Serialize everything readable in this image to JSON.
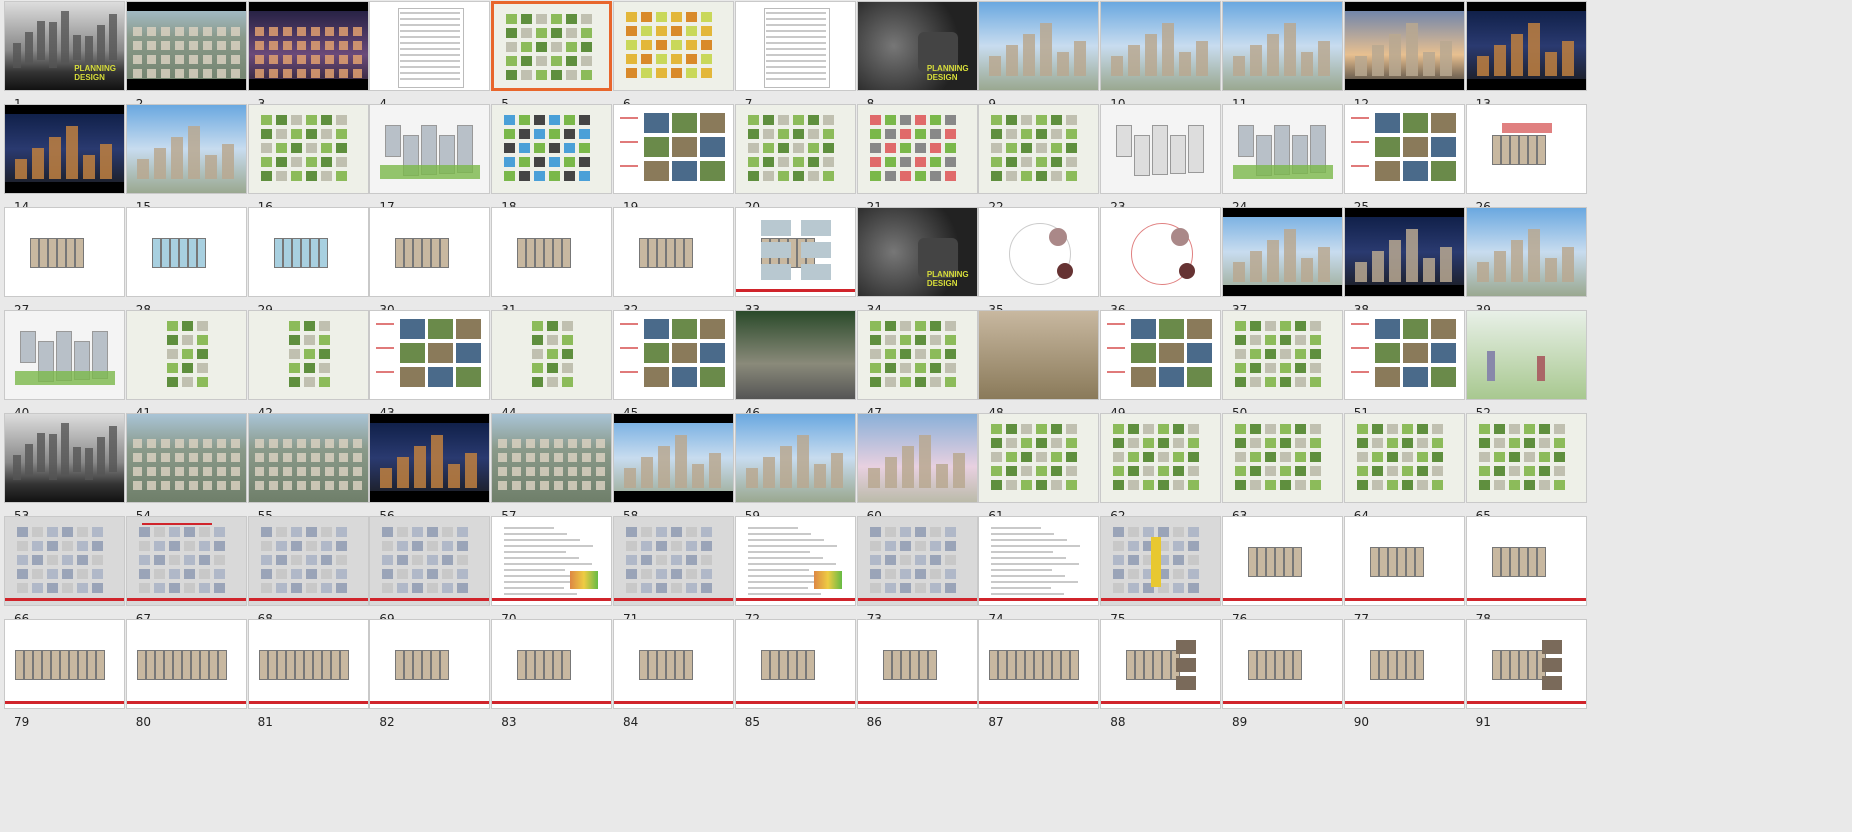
{
  "app": {
    "view": "slide sorter",
    "selected_slide": 5
  },
  "slides": [
    {
      "num": "1",
      "kind": "city-bw",
      "logo": "PLANNING\nDESIGN"
    },
    {
      "num": "2",
      "kind": "aerial"
    },
    {
      "num": "3",
      "kind": "aerial-night"
    },
    {
      "num": "4",
      "kind": "table"
    },
    {
      "num": "5",
      "kind": "plan-green"
    },
    {
      "num": "6",
      "kind": "plan-color"
    },
    {
      "num": "7",
      "kind": "table"
    },
    {
      "num": "8",
      "kind": "chairs",
      "logo": "PLANNING\nDESIGN"
    },
    {
      "num": "9",
      "kind": "render-day"
    },
    {
      "num": "10",
      "kind": "render-canal"
    },
    {
      "num": "11",
      "kind": "render-park"
    },
    {
      "num": "12",
      "kind": "render-dusk"
    },
    {
      "num": "13",
      "kind": "render-night"
    },
    {
      "num": "14",
      "kind": "render-night2"
    },
    {
      "num": "15",
      "kind": "render-street"
    },
    {
      "num": "16",
      "kind": "plan-mixed"
    },
    {
      "num": "17",
      "kind": "massing"
    },
    {
      "num": "18",
      "kind": "plan-blue"
    },
    {
      "num": "19",
      "kind": "photo-grid"
    },
    {
      "num": "20",
      "kind": "plan-mixed"
    },
    {
      "num": "21",
      "kind": "plan-red"
    },
    {
      "num": "22",
      "kind": "plan-mixed"
    },
    {
      "num": "23",
      "kind": "sketch"
    },
    {
      "num": "24",
      "kind": "massing-green"
    },
    {
      "num": "25",
      "kind": "photo-grid"
    },
    {
      "num": "26",
      "kind": "floorplan-red"
    },
    {
      "num": "27",
      "kind": "floorplan"
    },
    {
      "num": "28",
      "kind": "floorplan-blue"
    },
    {
      "num": "29",
      "kind": "floorplan-blue"
    },
    {
      "num": "30",
      "kind": "floorplan"
    },
    {
      "num": "31",
      "kind": "floorplan"
    },
    {
      "num": "32",
      "kind": "floorplan"
    },
    {
      "num": "33",
      "kind": "unit-grid"
    },
    {
      "num": "34",
      "kind": "chairs",
      "logo": "PLANNING\nDESIGN"
    },
    {
      "num": "35",
      "kind": "concept"
    },
    {
      "num": "36",
      "kind": "concept-pink"
    },
    {
      "num": "37",
      "kind": "render-resi"
    },
    {
      "num": "38",
      "kind": "render-resi-dark"
    },
    {
      "num": "39",
      "kind": "render-resi-day"
    },
    {
      "num": "40",
      "kind": "diagram-3d"
    },
    {
      "num": "41",
      "kind": "plan-narrow"
    },
    {
      "num": "42",
      "kind": "plan-narrow"
    },
    {
      "num": "43",
      "kind": "photo-grid"
    },
    {
      "num": "44",
      "kind": "plan-narrow"
    },
    {
      "num": "45",
      "kind": "photo-grid"
    },
    {
      "num": "46",
      "kind": "photo-courtyard"
    },
    {
      "num": "47",
      "kind": "plan-garden"
    },
    {
      "num": "48",
      "kind": "photo-villa"
    },
    {
      "num": "49",
      "kind": "photo-grid"
    },
    {
      "num": "50",
      "kind": "plan-path"
    },
    {
      "num": "51",
      "kind": "photo-grid"
    },
    {
      "num": "52",
      "kind": "section-people"
    },
    {
      "num": "53",
      "kind": "city-bw2"
    },
    {
      "num": "54",
      "kind": "aerial-resi"
    },
    {
      "num": "55",
      "kind": "aerial-resi2"
    },
    {
      "num": "56",
      "kind": "render-entry-night"
    },
    {
      "num": "57",
      "kind": "aerial-resi3"
    },
    {
      "num": "58",
      "kind": "render-pool"
    },
    {
      "num": "59",
      "kind": "render-gate"
    },
    {
      "num": "60",
      "kind": "render-blossom"
    },
    {
      "num": "61",
      "kind": "site-plan"
    },
    {
      "num": "62",
      "kind": "site-plan"
    },
    {
      "num": "63",
      "kind": "site-plan"
    },
    {
      "num": "64",
      "kind": "site-plan"
    },
    {
      "num": "65",
      "kind": "site-plan"
    },
    {
      "num": "66",
      "kind": "site-gray"
    },
    {
      "num": "67",
      "kind": "site-gray-red"
    },
    {
      "num": "68",
      "kind": "site-gray-green"
    },
    {
      "num": "69",
      "kind": "site-gray-photos"
    },
    {
      "num": "70",
      "kind": "text-page"
    },
    {
      "num": "71",
      "kind": "site-gray-green"
    },
    {
      "num": "72",
      "kind": "text-page"
    },
    {
      "num": "73",
      "kind": "site-gray"
    },
    {
      "num": "74",
      "kind": "text-page2"
    },
    {
      "num": "75",
      "kind": "site-gray-yellow"
    },
    {
      "num": "76",
      "kind": "unit-plan"
    },
    {
      "num": "77",
      "kind": "unit-plan"
    },
    {
      "num": "78",
      "kind": "unit-plan"
    },
    {
      "num": "79",
      "kind": "unit-plan-wide"
    },
    {
      "num": "80",
      "kind": "unit-plan-wide"
    },
    {
      "num": "81",
      "kind": "unit-plan-wide"
    },
    {
      "num": "82",
      "kind": "unit-plan"
    },
    {
      "num": "83",
      "kind": "unit-plan"
    },
    {
      "num": "84",
      "kind": "unit-plan"
    },
    {
      "num": "85",
      "kind": "unit-plan"
    },
    {
      "num": "86",
      "kind": "unit-plan"
    },
    {
      "num": "87",
      "kind": "unit-plan-wide"
    },
    {
      "num": "88",
      "kind": "unit-photos"
    },
    {
      "num": "89",
      "kind": "unit-plan"
    },
    {
      "num": "90",
      "kind": "unit-plan"
    },
    {
      "num": "91",
      "kind": "unit-photos"
    }
  ]
}
